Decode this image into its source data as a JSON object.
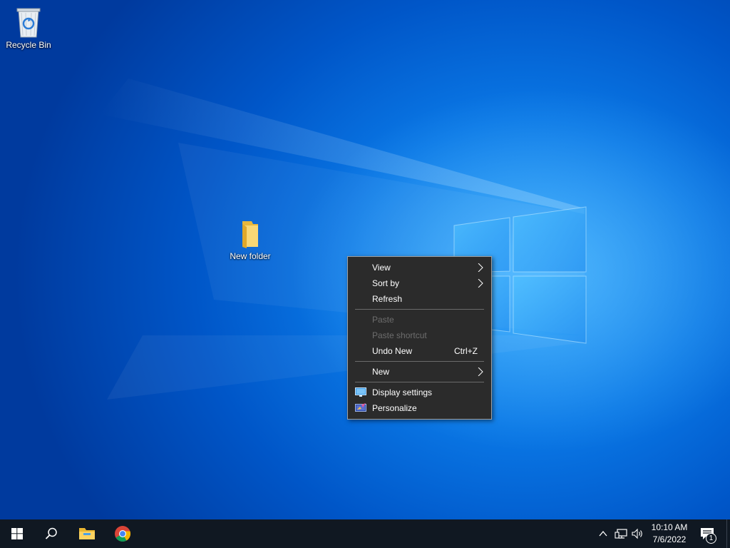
{
  "desktop": {
    "icons": [
      {
        "label": "Recycle Bin",
        "icon": "recycle-bin-icon"
      },
      {
        "label": "New folder",
        "icon": "folder-icon"
      }
    ]
  },
  "context_menu": {
    "items": [
      {
        "label": "View",
        "submenu": true,
        "enabled": true
      },
      {
        "label": "Sort by",
        "submenu": true,
        "enabled": true
      },
      {
        "label": "Refresh",
        "enabled": true
      },
      {
        "label": "Paste",
        "enabled": false
      },
      {
        "label": "Paste shortcut",
        "enabled": false
      },
      {
        "label": "Undo New",
        "shortcut": "Ctrl+Z",
        "enabled": true
      },
      {
        "label": "New",
        "submenu": true,
        "enabled": true
      },
      {
        "label": "Display settings",
        "icon": "display-settings-icon",
        "enabled": true
      },
      {
        "label": "Personalize",
        "icon": "personalize-icon",
        "enabled": true
      }
    ]
  },
  "taskbar": {
    "pinned": [
      {
        "name": "Start",
        "icon": "windows-logo-icon"
      },
      {
        "name": "Search",
        "icon": "search-icon"
      },
      {
        "name": "File Explorer",
        "icon": "folder-icon"
      },
      {
        "name": "Google Chrome",
        "icon": "chrome-icon"
      }
    ],
    "tray": {
      "icons": [
        "chevron-up-icon",
        "network-icon",
        "volume-icon"
      ],
      "time": "10:10 AM",
      "date": "7/6/2022",
      "notification_count": "1"
    }
  },
  "colors": {
    "desktop_accent": "#0a78e6",
    "menu_background": "#2b2b2b",
    "taskbar_background": "#101822"
  }
}
